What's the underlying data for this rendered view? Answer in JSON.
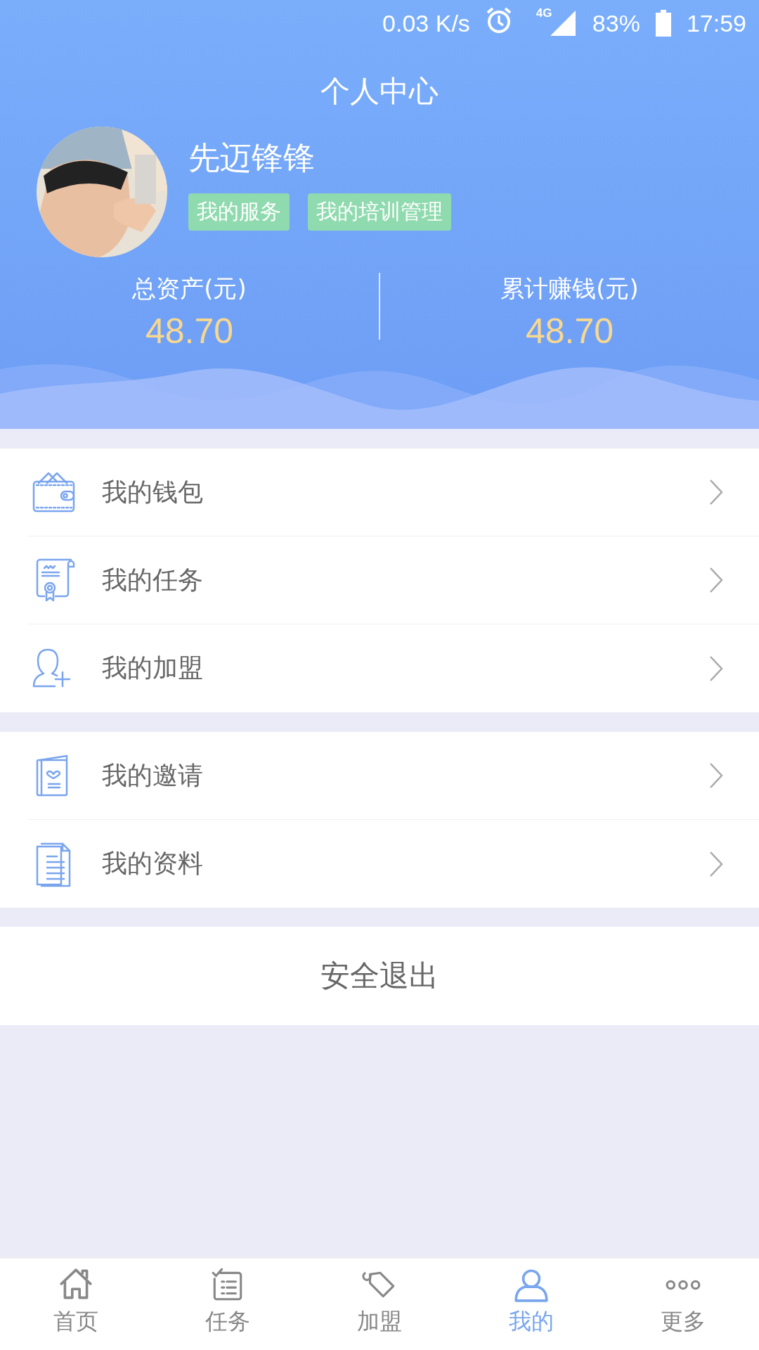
{
  "status_bar": {
    "speed": "0.03 K/s",
    "network": "4G",
    "battery": "83%",
    "time": "17:59"
  },
  "header": {
    "title": "个人中心",
    "user": {
      "name": "先迈锋锋",
      "tags": [
        "我的服务",
        "我的培训管理"
      ]
    },
    "stats": [
      {
        "label": "总资产(元)",
        "value": "48.70"
      },
      {
        "label": "累计赚钱(元)",
        "value": "48.70"
      }
    ]
  },
  "menu_groups": [
    [
      {
        "label": "我的钱包"
      },
      {
        "label": "我的任务"
      },
      {
        "label": "我的加盟"
      }
    ],
    [
      {
        "label": "我的邀请"
      },
      {
        "label": "我的资料"
      }
    ]
  ],
  "logout": {
    "label": "安全退出"
  },
  "tabs": [
    {
      "label": "首页",
      "selected": false
    },
    {
      "label": "任务",
      "selected": false
    },
    {
      "label": "加盟",
      "selected": false
    },
    {
      "label": "我的",
      "selected": true
    },
    {
      "label": "更多",
      "selected": false
    }
  ]
}
